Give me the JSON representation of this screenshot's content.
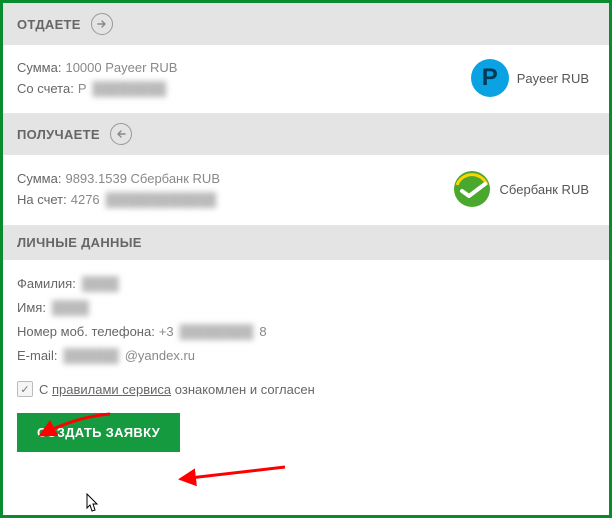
{
  "give": {
    "title": "ОТДАЕТЕ",
    "amount_label": "Сумма:",
    "amount_value": "10000 Payeer RUB",
    "account_label": "Со счета:",
    "account_prefix": "P",
    "account_masked": "████████",
    "badge": "Payeer RUB"
  },
  "get": {
    "title": "ПОЛУЧАЕТЕ",
    "amount_label": "Сумма:",
    "amount_value": "9893.1539 Сбербанк RUB",
    "account_label": "На счет:",
    "account_prefix": "4276",
    "account_masked": "████████████",
    "badge": "Сбербанк RUB"
  },
  "personal": {
    "title": "ЛИЧНЫЕ ДАННЫЕ",
    "lastname_label": "Фамилия:",
    "lastname_masked": "████",
    "firstname_label": "Имя:",
    "firstname_masked": "████",
    "phone_label": "Номер моб. телефона:",
    "phone_prefix": "+3",
    "phone_masked": "████████",
    "phone_suffix": "8",
    "email_label": "E-mail:",
    "email_masked": "██████",
    "email_suffix": "@yandex.ru"
  },
  "agree": {
    "text_pre": "С ",
    "link": "правилами сервиса",
    "text_post": " ознакомлен и согласен"
  },
  "submit_label": "СОЗДАТЬ ЗАЯВКУ",
  "colors": {
    "primary": "#169a3f",
    "arrow": "#ff0000"
  }
}
